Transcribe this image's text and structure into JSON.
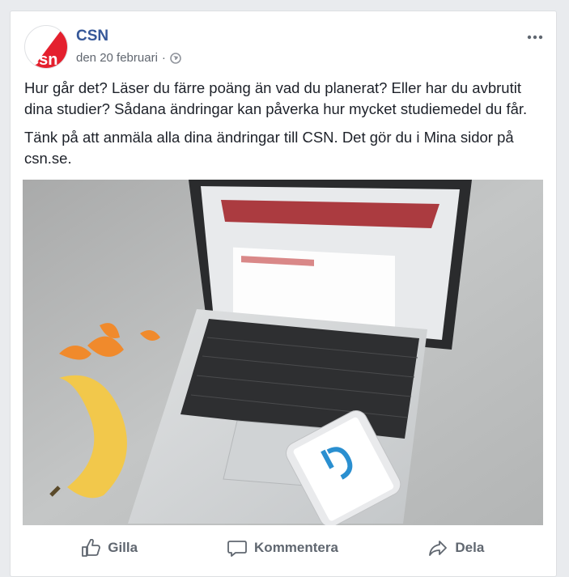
{
  "post": {
    "author": "CSN",
    "date": "den 20 februari",
    "separator": "·",
    "privacy_icon": "globe-icon",
    "paragraphs": [
      "Hur går det? Läser du färre poäng än vad du planerat? Eller har du avbrutit dina studier? Sådana ändringar kan påverka hur mycket studiemedel du får.",
      "Tänk på att anmäla alla dina ändringar till CSN. Det gör du i Mina sidor på csn.se."
    ],
    "avatar_logo_text": "csn",
    "photo_description_icon": "laptop-photo"
  },
  "actions": {
    "like": "Gilla",
    "comment": "Kommentera",
    "share": "Dela"
  },
  "colors": {
    "author": "#365899",
    "brand_red": "#e4202e",
    "action_text": "#606770"
  }
}
